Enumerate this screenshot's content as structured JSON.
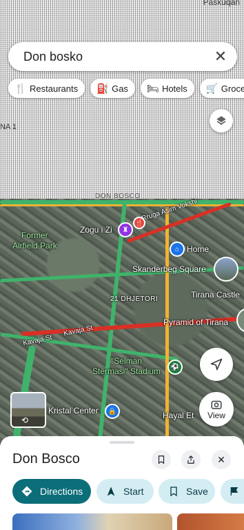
{
  "status": {
    "carrier": "Paskuqan"
  },
  "search": {
    "query": "Don bosko",
    "clear_icon": "close-icon"
  },
  "chips": [
    {
      "icon": "restaurant-icon",
      "label": "Restaurants"
    },
    {
      "icon": "gas-icon",
      "label": "Gas"
    },
    {
      "icon": "hotel-icon",
      "label": "Hotels"
    },
    {
      "icon": "cart-icon",
      "label": "Groceri"
    }
  ],
  "map": {
    "area_label": "DON BOSCO",
    "labels": {
      "former_airfield": "Former\nAirfield Park",
      "zogu": "Zogu i Zi",
      "asim": "Rruga Asim Vokshi",
      "home": "Home",
      "skanderbeg": "Skanderbeg Square",
      "dhjetori": "21 DHJETORI",
      "tirana_castle": "Tirana Castle",
      "pyramid": "Pyramid of Tirana",
      "kavaja1": "Kavaja St",
      "kavaja2": "Kavaja St",
      "selman": "\"Selman\nStërmasi\" Stadium",
      "kristal": "Kristal Center",
      "hayal": "Hayal Et",
      "na": "NA 1"
    },
    "view_label": "View"
  },
  "sheet": {
    "title": "Don Bosco",
    "actions": {
      "directions": "Directions",
      "start": "Start",
      "save": "Save"
    }
  },
  "colors": {
    "teal": "#0b6e78",
    "light_teal": "#d3edf3",
    "traffic_green": "#3fb36b",
    "traffic_red": "#d93025",
    "traffic_yellow": "#f2b233"
  }
}
